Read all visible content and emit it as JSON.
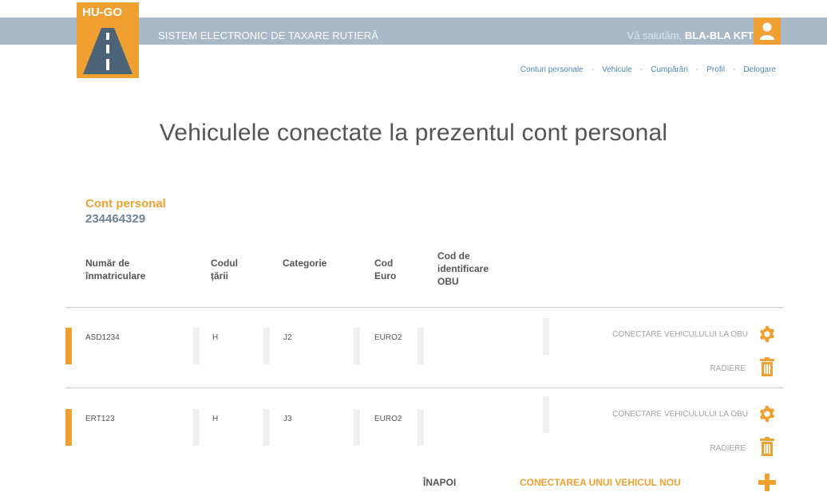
{
  "header": {
    "logo_text": "HU-GO",
    "system_title": "SISTEM ELECTRONIC DE TAXARE RUTIERĂ",
    "greeting": "Vă salutăm,",
    "user_name": "BLA-BLA KFT"
  },
  "nav": {
    "items": [
      "Conturi personale",
      "Vehicule",
      "Cumpărări",
      "Profil",
      "Delogare"
    ],
    "separator": "-"
  },
  "page_title": "Vehiculele conectate la prezentul cont personal",
  "account": {
    "label": "Cont personal",
    "number": "234464329"
  },
  "table": {
    "headers": {
      "plate": [
        "Număr de",
        "înmatriculare"
      ],
      "country": [
        "Codul",
        "țării"
      ],
      "category": "Categorie",
      "euro": [
        "Cod",
        "Euro"
      ],
      "obu": [
        "Cod de",
        "identificare",
        "OBU"
      ]
    },
    "rows": [
      {
        "plate": "ASD1234",
        "country": "H",
        "category": "J2",
        "euro": "EURO2",
        "obu": ""
      },
      {
        "plate": "ERT123",
        "country": "H",
        "category": "J3",
        "euro": "EURO2",
        "obu": ""
      }
    ],
    "actions": {
      "connect": "CONECTARE VEHICULULUI LA OBU",
      "delete": "RADIERE"
    }
  },
  "footer": {
    "back": "ÎNAPOI",
    "add_vehicle": "CONECTAREA UNUI VEHICUL NOU"
  },
  "colors": {
    "accent": "#f0a030",
    "header_band": "#a9b9c7",
    "link": "#4f89b0"
  },
  "icons": {
    "logo": "road-icon",
    "avatar": "user-icon",
    "connect": "gear-icon",
    "delete": "trash-icon",
    "add": "plus-icon"
  }
}
